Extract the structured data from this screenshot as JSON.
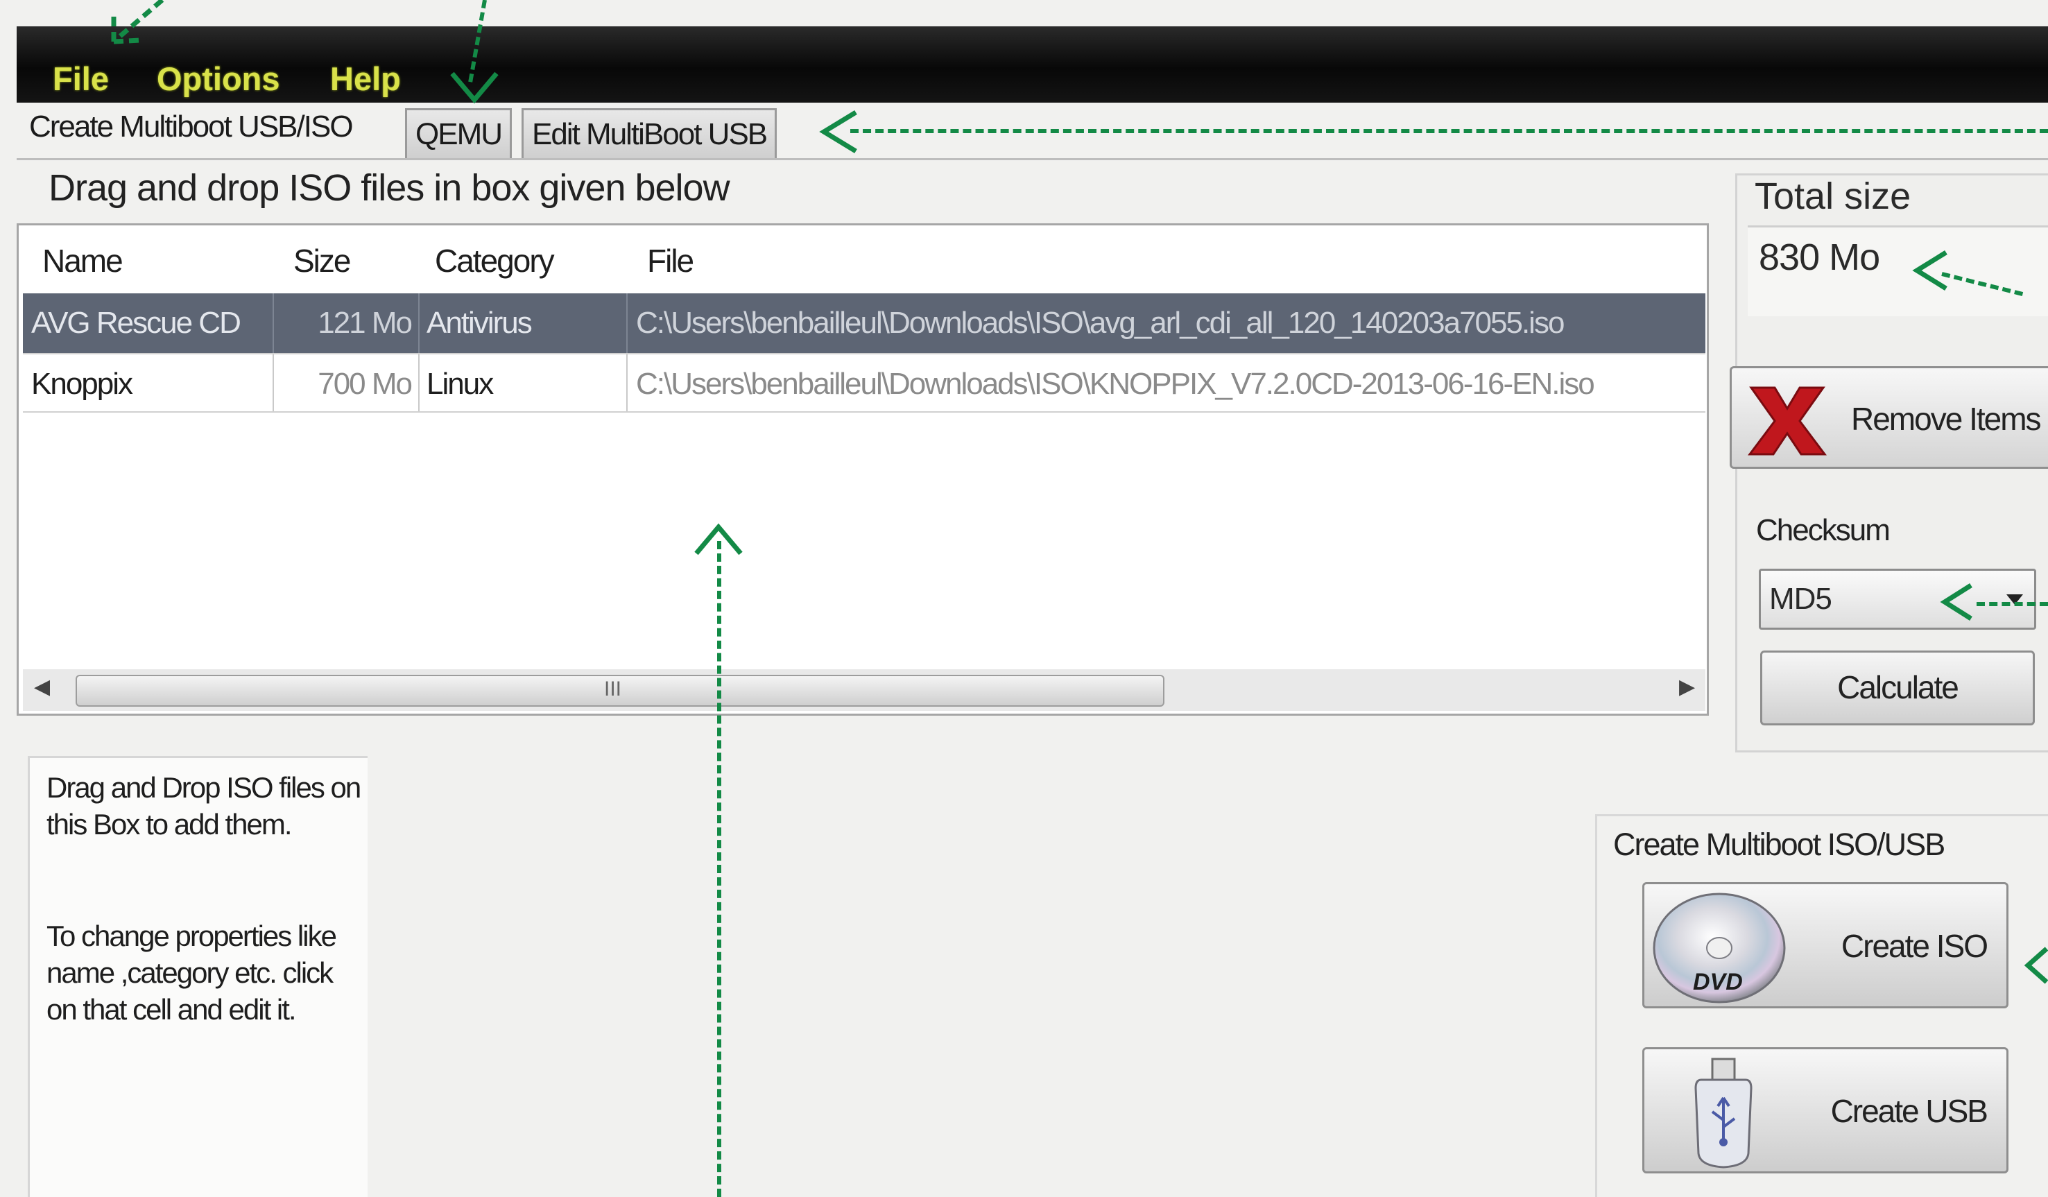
{
  "menu": {
    "items": [
      "File",
      "Options",
      "Help"
    ]
  },
  "tabs": [
    {
      "label": "Create Multiboot USB/ISO",
      "active": true
    },
    {
      "label": "QEMU",
      "active": false
    },
    {
      "label": "Edit MultiBoot USB",
      "active": false
    }
  ],
  "main": {
    "heading": "Drag and drop ISO files in box given below"
  },
  "grid": {
    "columns": [
      "Name",
      "Size",
      "Category",
      "File"
    ],
    "rows": [
      {
        "name": "AVG Rescue CD",
        "size": "121 Mo",
        "category": "Antivirus",
        "file": "C:\\Users\\benbailleul\\Downloads\\ISO\\avg_arl_cdi_all_120_140203a7055.iso",
        "selected": true
      },
      {
        "name": "Knoppix",
        "size": "700 Mo",
        "category": "Linux",
        "file": "C:\\Users\\benbailleul\\Downloads\\ISO\\KNOPPIX_V7.2.0CD-2013-06-16-EN.iso",
        "selected": false
      }
    ],
    "scroll_grip": "III"
  },
  "side": {
    "total_size_label": "Total size",
    "total_size_value": "830 Mo",
    "remove_label": "Remove Items",
    "checksum_label": "Checksum",
    "checksum_value": "MD5",
    "calculate_label": "Calculate"
  },
  "help": {
    "para1": "Drag and Drop ISO files on this Box to add them.",
    "para2": "To change properties like name ,category etc. click on that cell and edit it."
  },
  "create": {
    "group_label": "Create Multiboot ISO/USB",
    "iso_label": "Create ISO",
    "usb_label": "Create USB",
    "dvd_text": "DVD"
  },
  "icons": {
    "remove": "red-x-icon",
    "iso": "dvd-disc-icon",
    "usb": "usb-stick-icon",
    "dropdown": "chevron-down-icon"
  },
  "colors": {
    "menu_text": "#d9e24a",
    "annotation": "#138a46",
    "selected_row": "#5d6574",
    "remove_x": "#c0171d"
  }
}
